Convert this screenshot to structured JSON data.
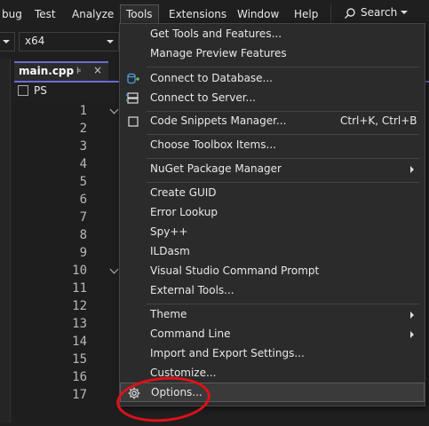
{
  "menubar": {
    "items": [
      "bug",
      "Test",
      "Analyze",
      "Tools",
      "Extensions",
      "Window",
      "Help"
    ],
    "search_label": "Search"
  },
  "toolbar": {
    "left_dropdown": "",
    "platform_dropdown": "x64"
  },
  "editor": {
    "tab_name": "main.cpp",
    "tab_pin": "⊧",
    "tab_close": "×",
    "scope": "PS",
    "line_numbers": [
      "1",
      "2",
      "3",
      "4",
      "5",
      "6",
      "7",
      "8",
      "9",
      "10",
      "11",
      "12",
      "13",
      "14",
      "15",
      "16",
      "17"
    ]
  },
  "tools_menu": {
    "items": [
      {
        "label": "Get Tools and Features..."
      },
      {
        "label": "Manage Preview Features"
      },
      {
        "label": "Connect to Database...",
        "icon": "database-connect-icon"
      },
      {
        "label": "Connect to Server...",
        "icon": "server-connect-icon"
      },
      {
        "label": "Code Snippets Manager...",
        "shortcut": "Ctrl+K, Ctrl+B",
        "icon": "snippet-icon"
      },
      {
        "label": "Choose Toolbox Items..."
      },
      {
        "label": "NuGet Package Manager",
        "submenu": true
      },
      {
        "label": "Create GUID"
      },
      {
        "label": "Error Lookup"
      },
      {
        "label": "Spy++"
      },
      {
        "label": "ILDasm"
      },
      {
        "label": "Visual Studio Command Prompt"
      },
      {
        "label": "External Tools..."
      },
      {
        "label": "Theme",
        "submenu": true
      },
      {
        "label": "Command Line",
        "submenu": true
      },
      {
        "label": "Import and Export Settings..."
      },
      {
        "label": "Customize..."
      },
      {
        "label": "Options...",
        "icon": "gear-icon",
        "highlighted": true
      }
    ]
  },
  "colors": {
    "accent": "#6b6bd6",
    "annotation": "#e0101a",
    "menu_bg": "#2b2b2b"
  }
}
